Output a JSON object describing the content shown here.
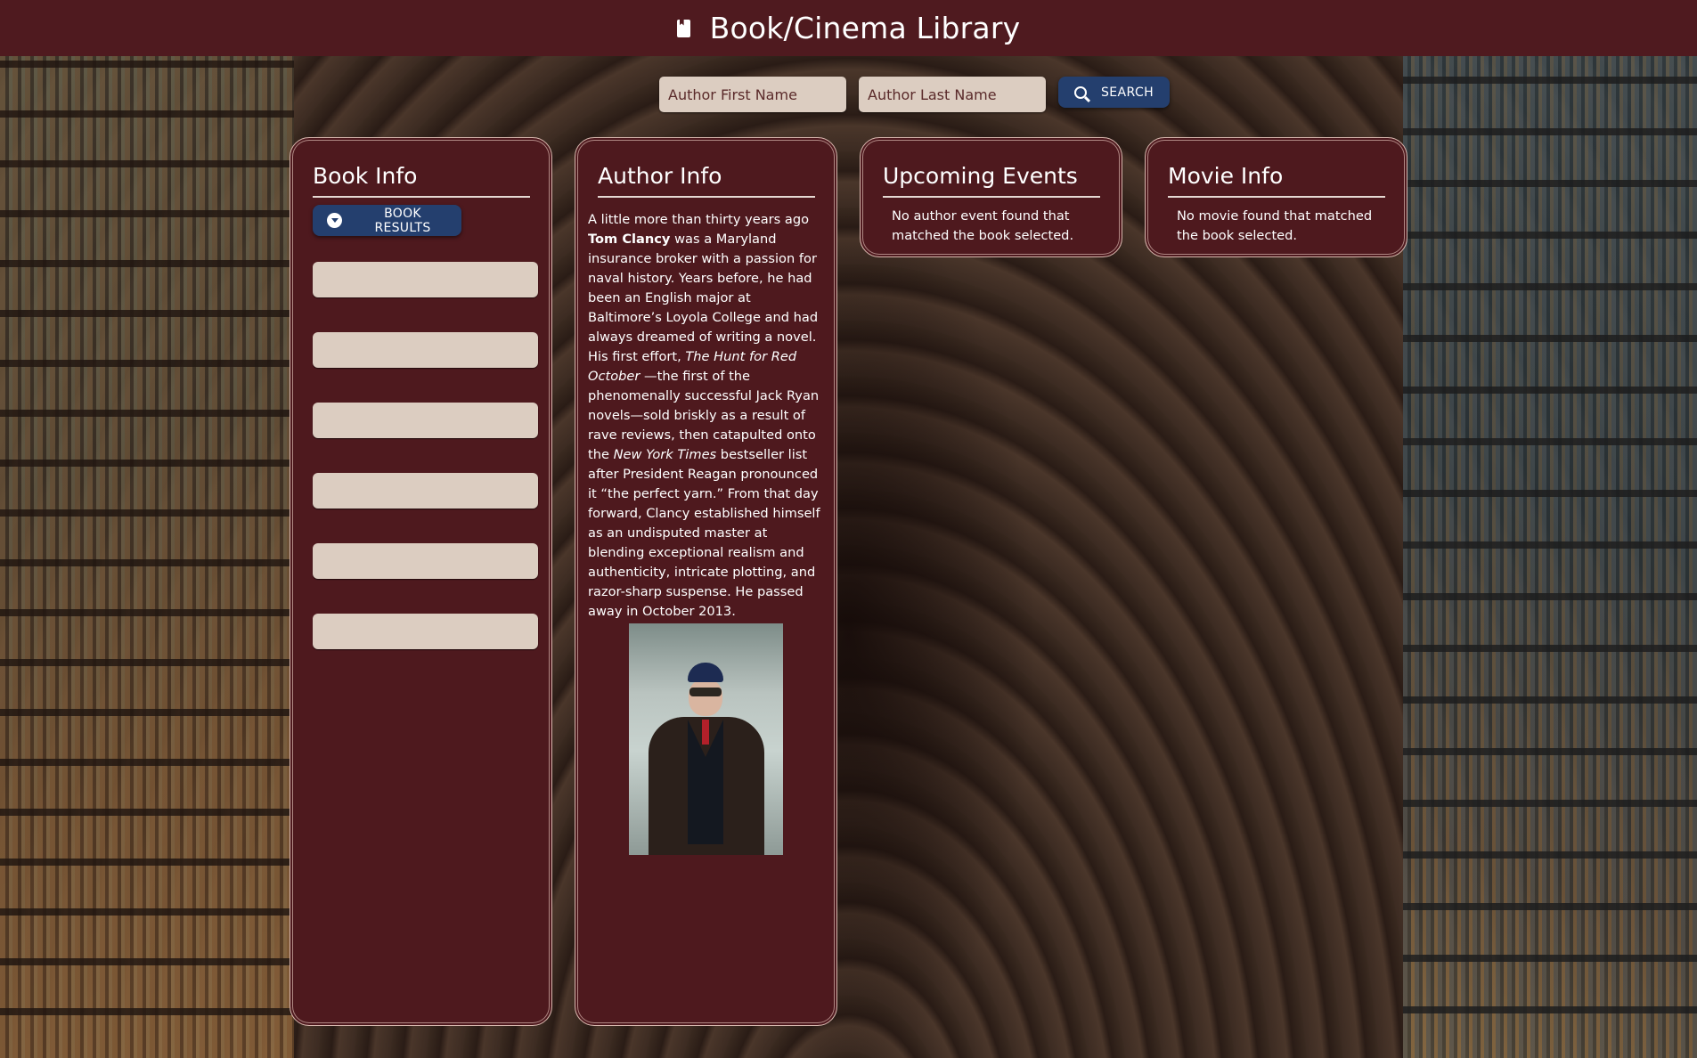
{
  "header": {
    "icon": "book-icon",
    "title": "Book/Cinema Library"
  },
  "search": {
    "first_name": {
      "value": "",
      "placeholder": "Author First Name"
    },
    "last_name": {
      "value": "",
      "placeholder": "Author Last Name"
    },
    "button_icon": "search-icon",
    "button_label": "SEARCH"
  },
  "book_info": {
    "title": "Book Info",
    "results_button": {
      "icon": "chevron-down-circle-icon",
      "label": "BOOK RESULTS"
    },
    "result_slots": [
      "",
      "",
      "",
      "",
      "",
      ""
    ]
  },
  "author_info": {
    "title": "Author Info",
    "bio": {
      "p1": "A little more than thirty years ago ",
      "name": "Tom Clancy",
      "p2": " was a Maryland insurance broker with a passion for naval history. Years before, he had been an English major at Baltimore’s Loyola College and had always dreamed of writing a novel. His first effort, ",
      "book": "The Hunt for Red October",
      "p3": " —the first of the phenomenally successful Jack Ryan novels—sold briskly as a result of rave reviews, then catapulted onto the ",
      "paper": "New York Times",
      "p4": " bestseller list after President Reagan pronounced it “the perfect yarn.” From that day forward, Clancy established himself as an undisputed master at blending exceptional realism and authenticity, intricate plotting, and razor-sharp suspense. He passed away in October 2013."
    },
    "photo_alt": "Tom Clancy"
  },
  "upcoming_events": {
    "title": "Upcoming Events",
    "message": "No author event found that matched the book selected."
  },
  "movie_info": {
    "title": "Movie Info",
    "message": "No movie found that matched the book selected."
  },
  "colors": {
    "header_bg": "#4f1a1f",
    "card_bg": "#4e191e",
    "button_bg": "#243f6e",
    "input_bg": "#dccdc1"
  }
}
